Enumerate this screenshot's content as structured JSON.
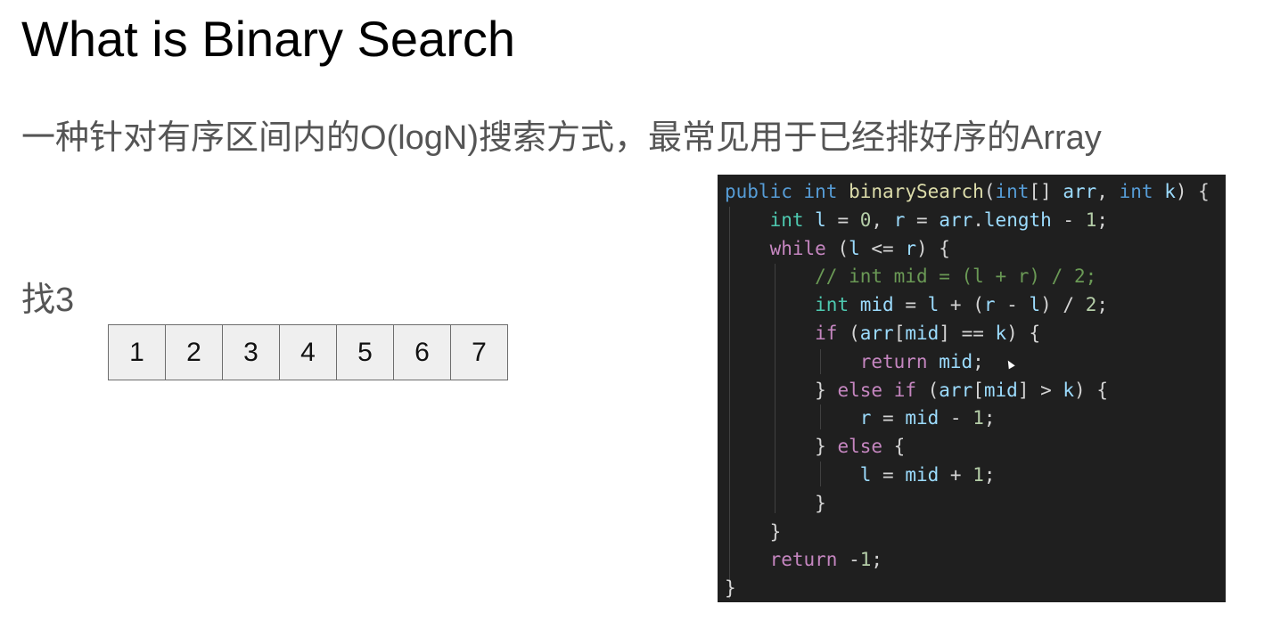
{
  "slide": {
    "title": "What is Binary Search",
    "subtitle": "一种针对有序区间内的O(logN)搜索方式，最常见用于已经排好序的Array",
    "find_label": "找3"
  },
  "array": {
    "cells": [
      "1",
      "2",
      "3",
      "4",
      "5",
      "6",
      "7"
    ]
  },
  "code": {
    "l1": {
      "public": "public",
      "int": "int",
      "fn": "binarySearch",
      "p1": "(",
      "int2": "int",
      "p2": "[] ",
      "arr": "arr",
      "p3": ", ",
      "int3": "int",
      "p4": " ",
      "k": "k",
      "p5": ") {"
    },
    "l2": {
      "int": "int",
      "p1": " ",
      "l": "l",
      "p2": " = ",
      "zero": "0",
      "p3": ", ",
      "r": "r",
      "p4": " = ",
      "arr": "arr",
      "p5": ".",
      "length": "length",
      "p6": " - ",
      "one": "1",
      "p7": ";"
    },
    "l3": {
      "while": "while",
      "p1": " (",
      "l": "l",
      "p2": " <= ",
      "r": "r",
      "p3": ") {"
    },
    "l4": {
      "comment": "// int mid = (l + r) / 2;"
    },
    "l5": {
      "int": "int",
      "p1": " ",
      "mid": "mid",
      "p2": " = ",
      "l": "l",
      "p3": " + (",
      "r": "r",
      "p4": " - ",
      "l2": "l",
      "p5": ") / ",
      "two": "2",
      "p6": ";"
    },
    "l6": {
      "if": "if",
      "p1": " (",
      "arr": "arr",
      "p2": "[",
      "mid": "mid",
      "p3": "] == ",
      "k": "k",
      "p4": ") {"
    },
    "l7": {
      "return": "return",
      "p1": " ",
      "mid": "mid",
      "p2": ";"
    },
    "l8": {
      "p0": "} ",
      "else": "else",
      "p1": " ",
      "if": "if",
      "p2": " (",
      "arr": "arr",
      "p3": "[",
      "mid": "mid",
      "p4": "] > ",
      "k": "k",
      "p5": ") {"
    },
    "l9": {
      "r": "r",
      "p1": " = ",
      "mid": "mid",
      "p2": " - ",
      "one": "1",
      "p3": ";"
    },
    "l10": {
      "p0": "} ",
      "else": "else",
      "p1": " {"
    },
    "l11": {
      "l": "l",
      "p1": " = ",
      "mid": "mid",
      "p2": " + ",
      "one": "1",
      "p3": ";"
    },
    "l12": {
      "brace": "}"
    },
    "l13": {
      "brace": "}"
    },
    "l14": {
      "return": "return",
      "p1": " -",
      "one": "1",
      "p2": ";"
    },
    "l15": {
      "brace": "}"
    }
  },
  "colors": {
    "code_background": "#1f1f1f",
    "keyword_blue": "#569cd6",
    "keyword_purple": "#c586c0",
    "type": "#4ec9b0",
    "function": "#dcdcaa",
    "variable": "#9cdcfe",
    "number": "#b5cea8",
    "comment": "#6a9955",
    "array_cell_fill": "#efefef"
  }
}
